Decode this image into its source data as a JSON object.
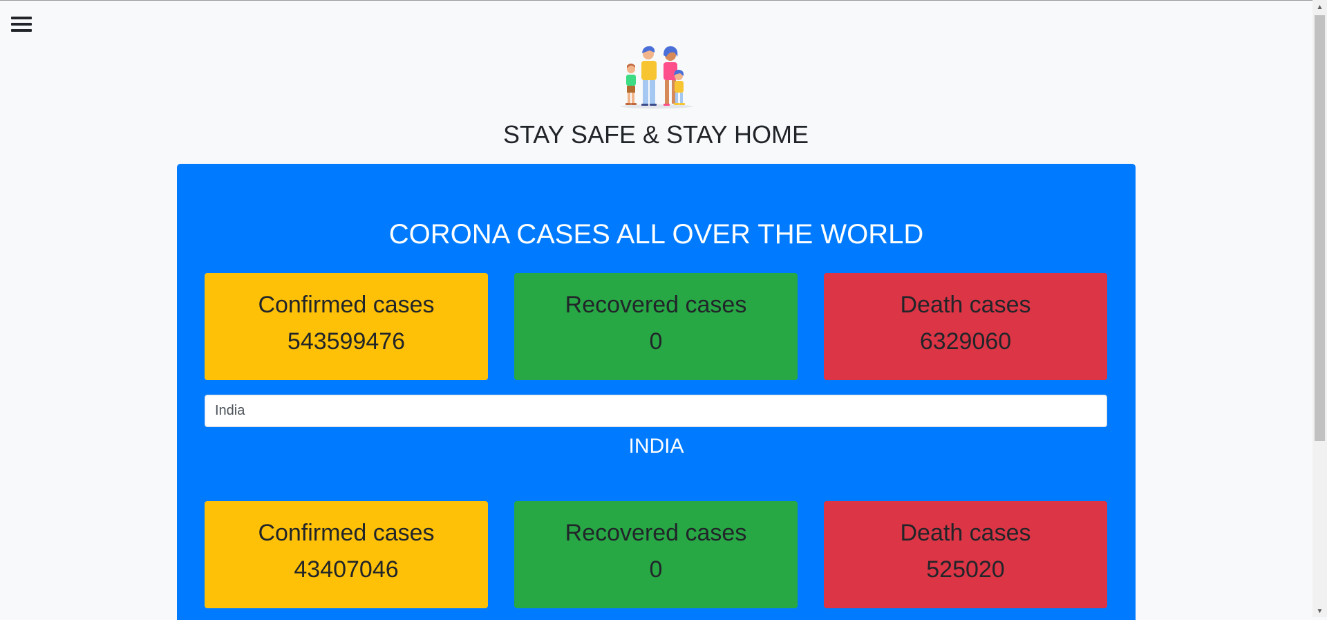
{
  "header": {
    "menu_icon": "hamburger-menu-icon",
    "logo_icon": "family-illustration-icon",
    "headline": "STAY SAFE & STAY HOME"
  },
  "world": {
    "title": "CORONA CASES ALL OVER THE WORLD",
    "confirmed": {
      "label": "Confirmed cases",
      "value": "543599476"
    },
    "recovered": {
      "label": "Recovered cases",
      "value": "0"
    },
    "deaths": {
      "label": "Death cases",
      "value": "6329060"
    }
  },
  "search": {
    "value": "India"
  },
  "country": {
    "name": "INDIA",
    "confirmed": {
      "label": "Confirmed cases",
      "value": "43407046"
    },
    "recovered": {
      "label": "Recovered cases",
      "value": "0"
    },
    "deaths": {
      "label": "Death cases",
      "value": "525020"
    }
  },
  "colors": {
    "page_background": "#f8f9fa",
    "panel": "#007bff",
    "confirmed": "#ffc107",
    "recovered": "#28a745",
    "deaths": "#dc3545"
  }
}
